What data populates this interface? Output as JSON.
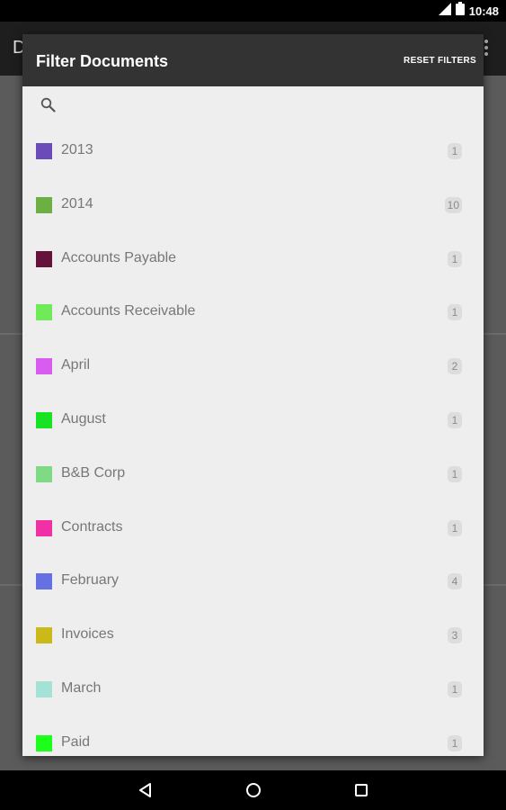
{
  "status_bar": {
    "time": "10:48"
  },
  "app_bar": {
    "title": "D"
  },
  "dialog": {
    "title": "Filter Documents",
    "reset_label": "RESET FILTERS",
    "search_placeholder": ""
  },
  "filters": [
    {
      "label": "2013",
      "count": "1",
      "color": "#6b4bb8"
    },
    {
      "label": "2014",
      "count": "10",
      "color": "#6cb043"
    },
    {
      "label": "Accounts Payable",
      "count": "1",
      "color": "#65133a"
    },
    {
      "label": "Accounts Receivable",
      "count": "1",
      "color": "#6fea59"
    },
    {
      "label": "April",
      "count": "2",
      "color": "#d85cf0"
    },
    {
      "label": "August",
      "count": "1",
      "color": "#18e322"
    },
    {
      "label": "B&B Corp",
      "count": "1",
      "color": "#80d985"
    },
    {
      "label": "Contracts",
      "count": "1",
      "color": "#f230a6"
    },
    {
      "label": "February",
      "count": "4",
      "color": "#6570e3"
    },
    {
      "label": "Invoices",
      "count": "3",
      "color": "#cbb91a"
    },
    {
      "label": "March",
      "count": "1",
      "color": "#a3e2d5"
    },
    {
      "label": "Paid",
      "count": "1",
      "color": "#1bff1b"
    }
  ]
}
